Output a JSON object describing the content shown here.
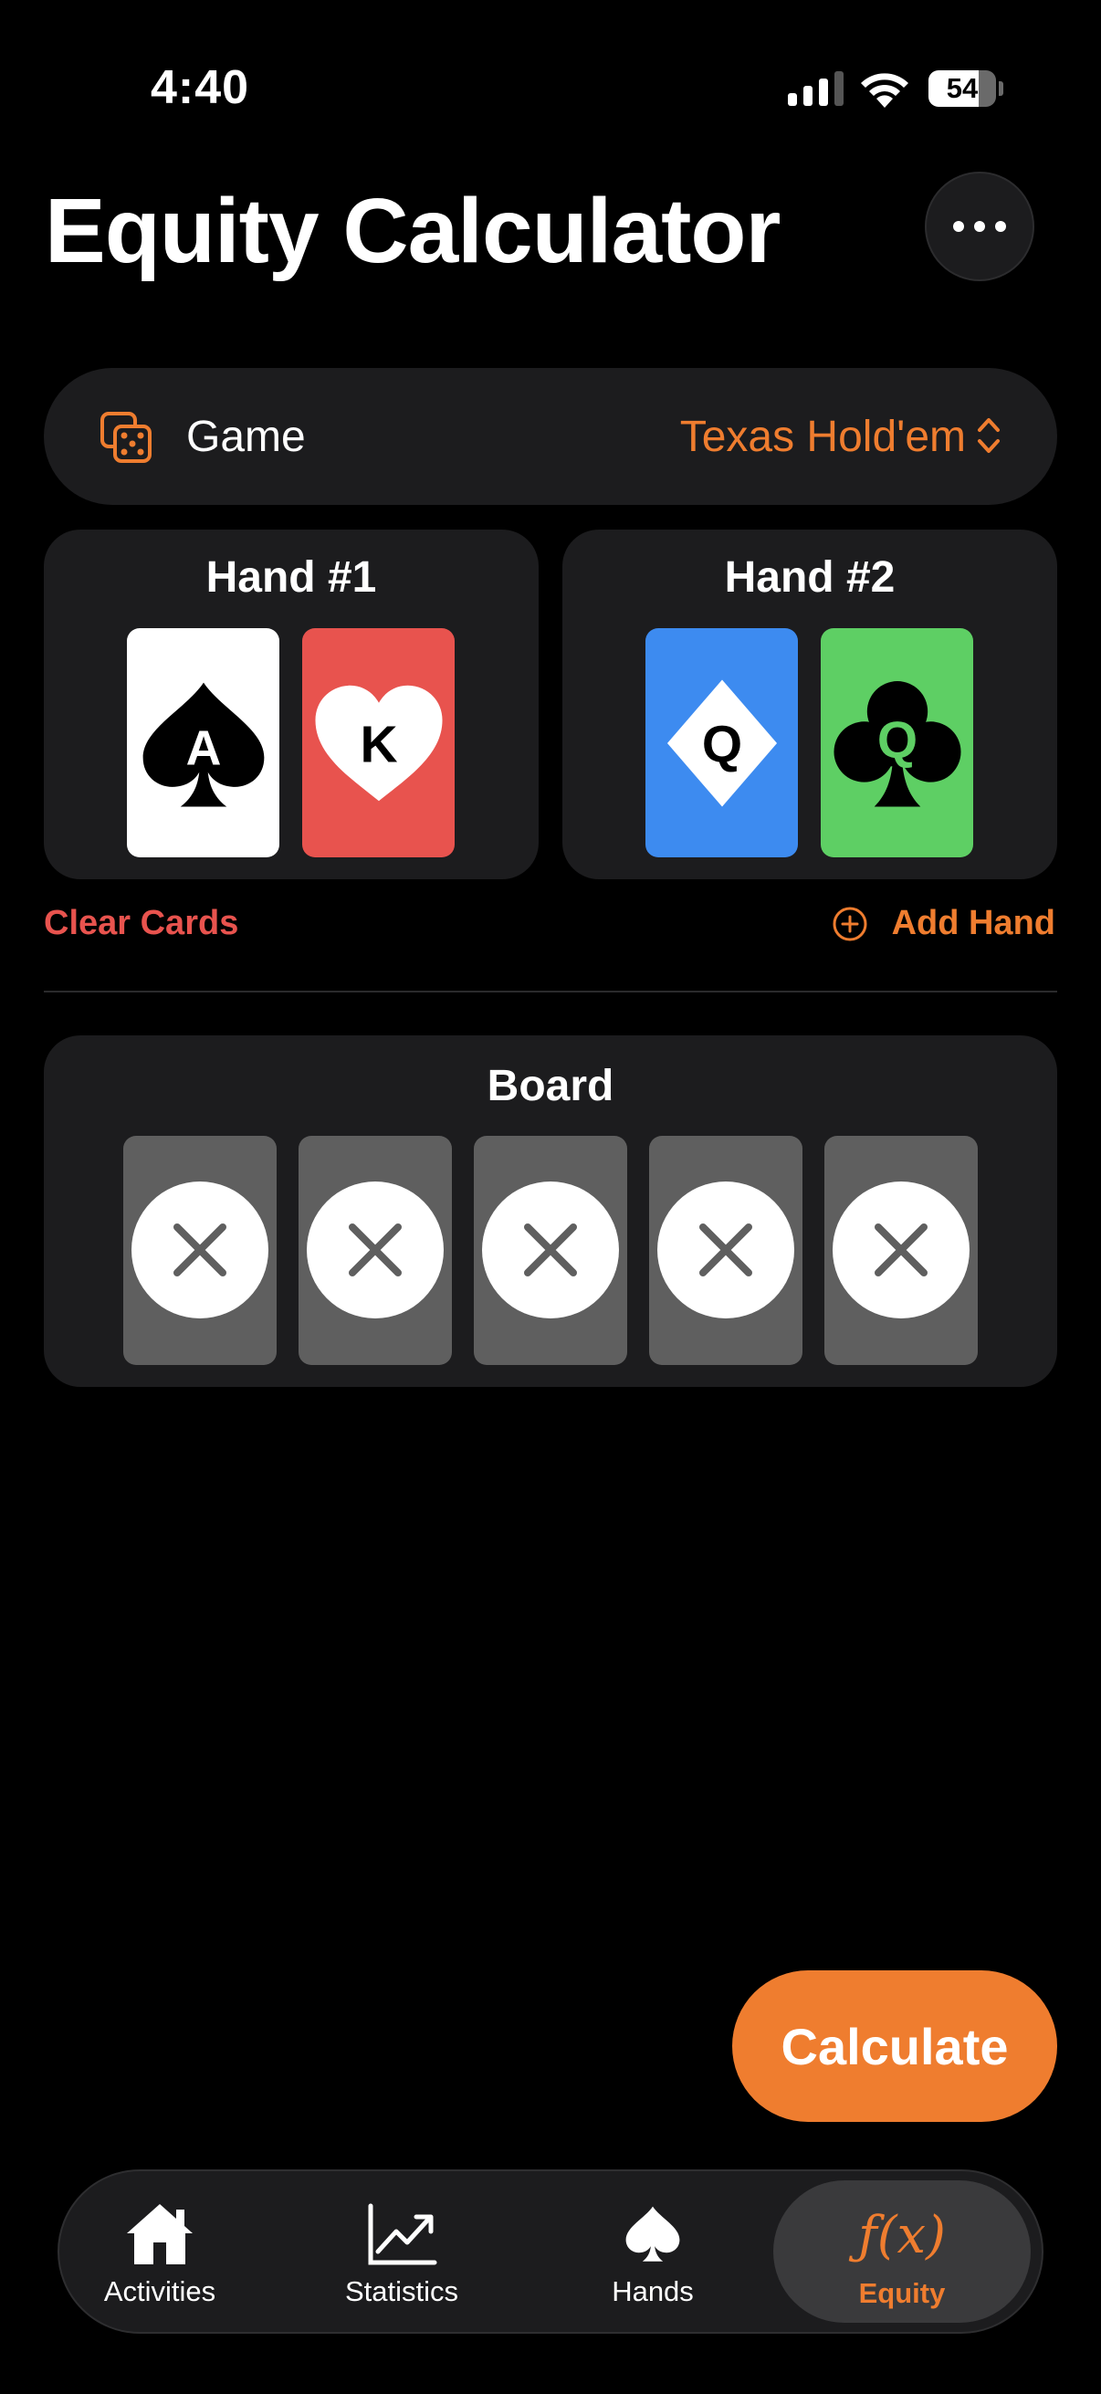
{
  "status_bar": {
    "time": "4:40",
    "battery_level": "54"
  },
  "header": {
    "title": "Equity Calculator",
    "more_icon": "ellipsis-icon"
  },
  "game": {
    "label": "Game",
    "value": "Texas Hold'em",
    "icon": "dice-icon"
  },
  "hands": [
    {
      "title": "Hand #1",
      "cards": [
        {
          "rank": "A",
          "suit": "spades",
          "color": "#ffffff"
        },
        {
          "rank": "K",
          "suit": "hearts",
          "color": "#e8534e"
        }
      ]
    },
    {
      "title": "Hand #2",
      "cards": [
        {
          "rank": "Q",
          "suit": "diamonds",
          "color": "#3d8bf0"
        },
        {
          "rank": "Q",
          "suit": "clubs",
          "color": "#5ecf64"
        }
      ]
    }
  ],
  "actions": {
    "clear_cards": "Clear Cards",
    "add_hand": "Add Hand"
  },
  "board": {
    "title": "Board",
    "slots": [
      "empty",
      "empty",
      "empty",
      "empty",
      "empty"
    ]
  },
  "calculate": {
    "label": "Calculate"
  },
  "tab_bar": {
    "tabs": [
      {
        "label": "Activities",
        "icon": "house-icon",
        "active": false
      },
      {
        "label": "Statistics",
        "icon": "chart-line-icon",
        "active": false
      },
      {
        "label": "Hands",
        "icon": "spade-icon",
        "active": false
      },
      {
        "label": "Equity",
        "icon": "function-icon",
        "icon_text": "ƒ(x)",
        "active": true
      }
    ]
  },
  "colors": {
    "accent": "#ef7d2f",
    "danger": "#e8534e",
    "panel": "#1c1c1e",
    "background": "#000000"
  }
}
